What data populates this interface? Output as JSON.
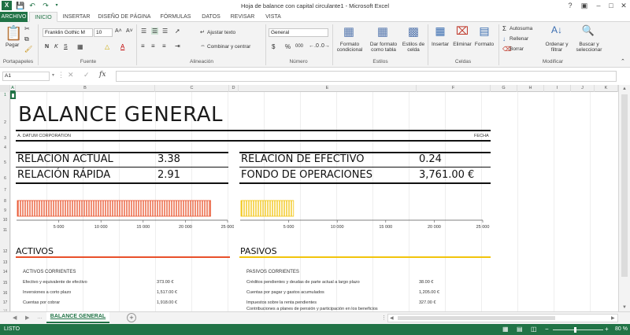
{
  "window": {
    "title": "Hoja de balance con capital circulante1 - Microsoft Excel",
    "help": "?",
    "minimize": "–",
    "restore": "□",
    "close": "✕"
  },
  "tabs": [
    "ARCHIVO",
    "INICIO",
    "INSERTAR",
    "DISEÑO DE PÁGINA",
    "FÓRMULAS",
    "DATOS",
    "REVISAR",
    "VISTA"
  ],
  "ribbon": {
    "clipboard": {
      "paste": "Pegar",
      "label": "Portapapeles"
    },
    "font": {
      "name": "Franklin Gothic M",
      "size": "10",
      "bold": "N",
      "italic": "K",
      "underline": "S",
      "label": "Fuente"
    },
    "alignment": {
      "wrap": "Ajustar texto",
      "merge": "Combinar y centrar",
      "label": "Alineación"
    },
    "number": {
      "format": "General",
      "currency": "$",
      "percent": "%",
      "thousands": "000",
      "label": "Número"
    },
    "styles": {
      "conditional": [
        "Formato",
        "condicional"
      ],
      "as_table": [
        "Dar formato",
        "como tabla"
      ],
      "cell_styles": [
        "Estilos de",
        "celda"
      ],
      "label": "Estilos"
    },
    "cells": {
      "insert": "Insertar",
      "delete": "Eliminar",
      "format": "Formato",
      "label": "Celdas"
    },
    "editing": {
      "autosum": "Autosuma",
      "fill": "Rellenar",
      "clear": "Borrar",
      "sort": [
        "Ordenar y",
        "filtrar"
      ],
      "find": [
        "Buscar y",
        "seleccionar"
      ],
      "label": "Modificar"
    }
  },
  "formula_bar": {
    "name_box": "A1",
    "fx": "fx",
    "value": ""
  },
  "columns": [
    "A",
    "B",
    "C",
    "D",
    "E",
    "F",
    "G",
    "H",
    "I",
    "J",
    "K"
  ],
  "rows": [
    "1",
    "2",
    "3",
    "4",
    "5",
    "6",
    "7",
    "8",
    "9",
    "10",
    "11",
    "12",
    "13",
    "14",
    "15",
    "16",
    "17",
    "18"
  ],
  "sheet": {
    "title": "BALANCE GENERAL",
    "company": "A. DATUM CORPORATION",
    "date_label": "FECHA",
    "metrics_left": [
      {
        "label": "RELACIÓN ACTUAL",
        "value": "3.38"
      },
      {
        "label": "RELACIÓN RÁPIDA",
        "value": "2.91"
      }
    ],
    "metrics_right": [
      {
        "label": "RELACIÓN DE EFECTIVO",
        "value": "0.24"
      },
      {
        "label": "FONDO DE OPERACIONES",
        "value": "3,761.00 €"
      }
    ],
    "activos": {
      "title": "ACTIVOS",
      "subtitle": "ACTIVOS CORRIENTES",
      "items": [
        {
          "label": "Efectivo y equivalente de efectivo",
          "value": "373.00 €"
        },
        {
          "label": "Inversiones a corto plazo",
          "value": "1,517.00 €"
        },
        {
          "label": "Cuentas por cobrar",
          "value": "1,918.00 €"
        }
      ]
    },
    "pasivos": {
      "title": "PASIVOS",
      "subtitle": "PASIVOS CORRIENTES",
      "items": [
        {
          "label": "Créditos pendientes y deudas de parte actual a largo plazo",
          "value": "38.00 €"
        },
        {
          "label": "Cuentas por pagar y gastos acumulados",
          "value": "1,205.00 €"
        },
        {
          "label": "Impuestos sobre la renta pendientes",
          "value": "327.00 €"
        },
        {
          "label": "Contribuciones a planes de pensión y participación en los beneficios",
          "value": ""
        }
      ]
    }
  },
  "chart_data": [
    {
      "type": "bar",
      "orientation": "horizontal",
      "categories": [
        ""
      ],
      "values": [
        23000
      ],
      "color": "#e8502a",
      "xlim": [
        0,
        25000
      ],
      "xticks": [
        "5 000",
        "10 000",
        "15 000",
        "20 000",
        "25 000"
      ]
    },
    {
      "type": "bar",
      "orientation": "horizontal",
      "categories": [
        ""
      ],
      "values": [
        5500
      ],
      "color": "#f2c40c",
      "xlim": [
        0,
        25000
      ],
      "xticks": [
        "5 000",
        "10 000",
        "15 000",
        "20 000",
        "25 000"
      ]
    }
  ],
  "sheet_tab": "BALANCE GENERAL",
  "status": {
    "text": "LISTO",
    "zoom": "80 %"
  },
  "colors": {
    "excel_green": "#217346",
    "activos_accent": "#e8502a",
    "pasivos_accent": "#f2c40c"
  }
}
